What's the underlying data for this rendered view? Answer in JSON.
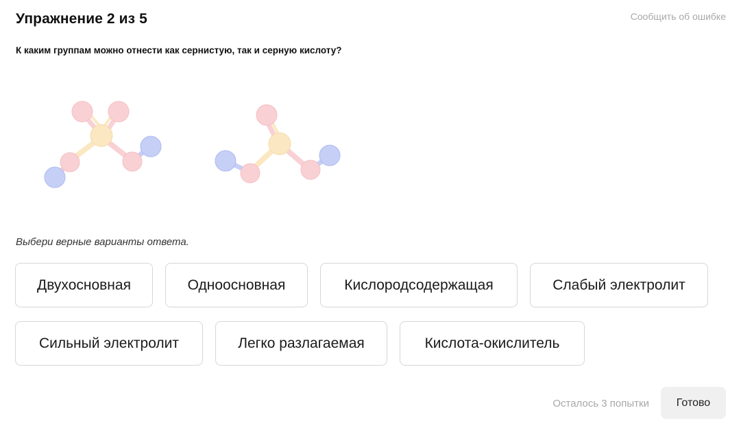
{
  "header": {
    "title": "Упражнение 2 из 5",
    "report_link": "Сообщить об ошибке"
  },
  "question": "К каким группам можно отнести как сернистую, так и серную кислоту?",
  "illustration": {
    "molecules": [
      "sulfuric-acid-molecule",
      "sulfurous-acid-molecule"
    ],
    "colors": {
      "oxygen": "#f9cfd2",
      "sulfur": "#fbe7bf",
      "hydrogen": "#c3cdf6"
    }
  },
  "hint": "Выбери верные варианты ответа.",
  "options": [
    "Двухосновная",
    "Одноосновная",
    "Кислородсодержащая",
    "Слабый электролит",
    "Сильный электролит",
    "Легко разлагаемая",
    "Кислота-окислитель"
  ],
  "footer": {
    "attempts_text": "Осталось 3 попытки",
    "submit_label": "Готово"
  }
}
